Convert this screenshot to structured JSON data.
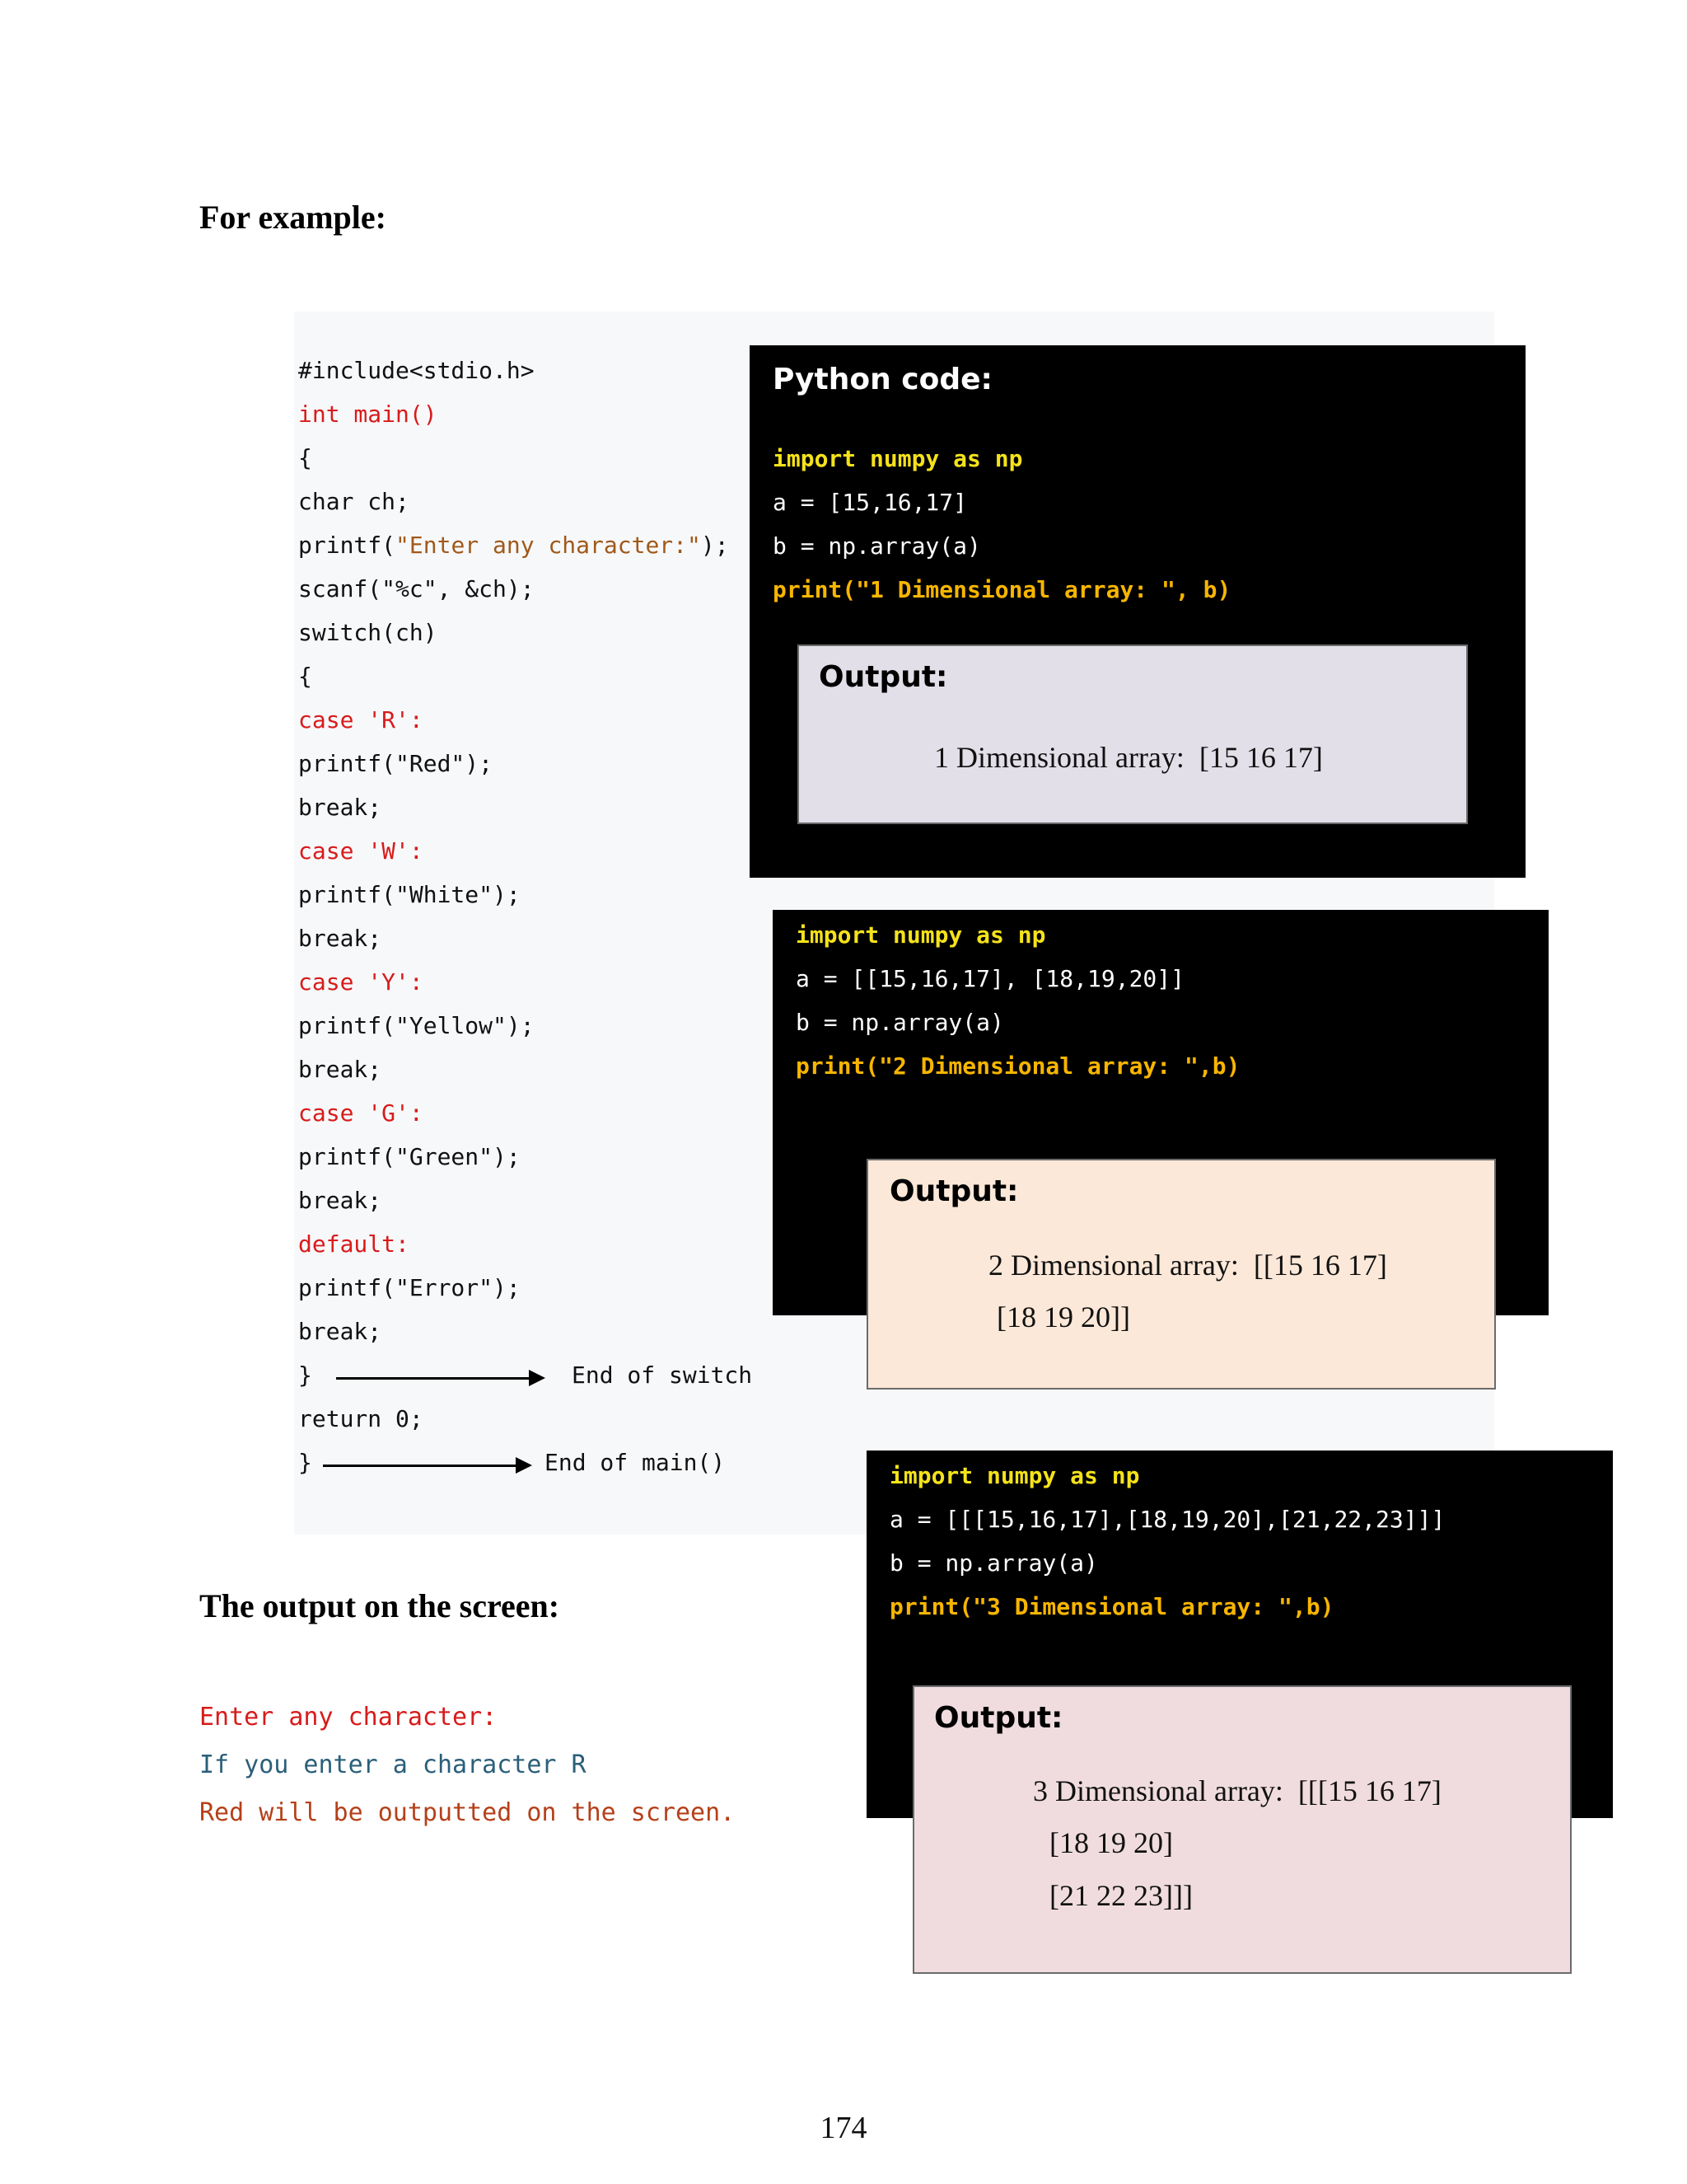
{
  "headings": {
    "example": "For example:",
    "screen_output": "The output on the screen:"
  },
  "c_code": {
    "include": "#include<stdio.h>",
    "main": "int main()",
    "open_brace": "{",
    "decl": "char ch;",
    "printf_prefix": "printf(",
    "printf_string": "\"Enter any character:\"",
    "printf_suffix": ");",
    "scanf": "scanf(\"%c\", &ch);",
    "switch": "switch(ch)",
    "switch_brace": "{",
    "case_r": "case 'R':",
    "print_red": "printf(\"Red\");",
    "break1": "break;",
    "case_w": "case 'W':",
    "print_white": "printf(\"White\");",
    "break2": "break;",
    "case_y": "case 'Y':",
    "print_yellow": "printf(\"Yellow\");",
    "break3": "break;",
    "case_g": "case 'G':",
    "print_green": "printf(\"Green\");",
    "break4": "break;",
    "default": "default:",
    "print_error": "printf(\"Error\");",
    "break5": "break;",
    "close_switch": "}",
    "return": "return 0;",
    "close_main": "}",
    "end_switch_note": "End of switch",
    "end_main_note": "End of main()"
  },
  "python_1": {
    "title": "Python code:",
    "import": "import numpy as np",
    "assign_a": "a = [15,16,17]",
    "assign_b": "b = np.array(a)",
    "print": "print(\"1 Dimensional array: \", b)",
    "output_label": "Output:",
    "output_line1": "1 Dimensional array:  [15 16 17]"
  },
  "python_2": {
    "import": "import numpy as np",
    "assign_a": "a = [[15,16,17], [18,19,20]]",
    "assign_b": "b = np.array(a)",
    "print": "print(\"2 Dimensional array: \",b)",
    "output_label": "Output:",
    "output_line1": "2 Dimensional array:  [[15 16 17]",
    "output_line2": "[18 19 20]]"
  },
  "python_3": {
    "import": "import numpy as np",
    "assign_a": "a = [[[15,16,17],[18,19,20],[21,22,23]]]",
    "assign_b": "b = np.array(a)",
    "print": "print(\"3 Dimensional array: \",b)",
    "output_label": "Output:",
    "output_line1": "3 Dimensional array:  [[[15 16 17]",
    "output_line2": "[18 19 20]",
    "output_line3": "[21 22 23]]]"
  },
  "screen": {
    "line1": "Enter any character:",
    "line2": "If you enter a character R",
    "line3": "Red will be outputted on the screen."
  },
  "page_number": "174",
  "colors": {
    "keyword_red": "#d81b1b",
    "string_brown": "#a0591a",
    "python_yellow": "#f5e21a",
    "python_amber": "#f7b500",
    "output1_bg": "#e2dfe8",
    "output2_bg": "#fbe8d8",
    "output3_bg": "#f0dcdf",
    "screen_blue": "#2a5f7a"
  }
}
